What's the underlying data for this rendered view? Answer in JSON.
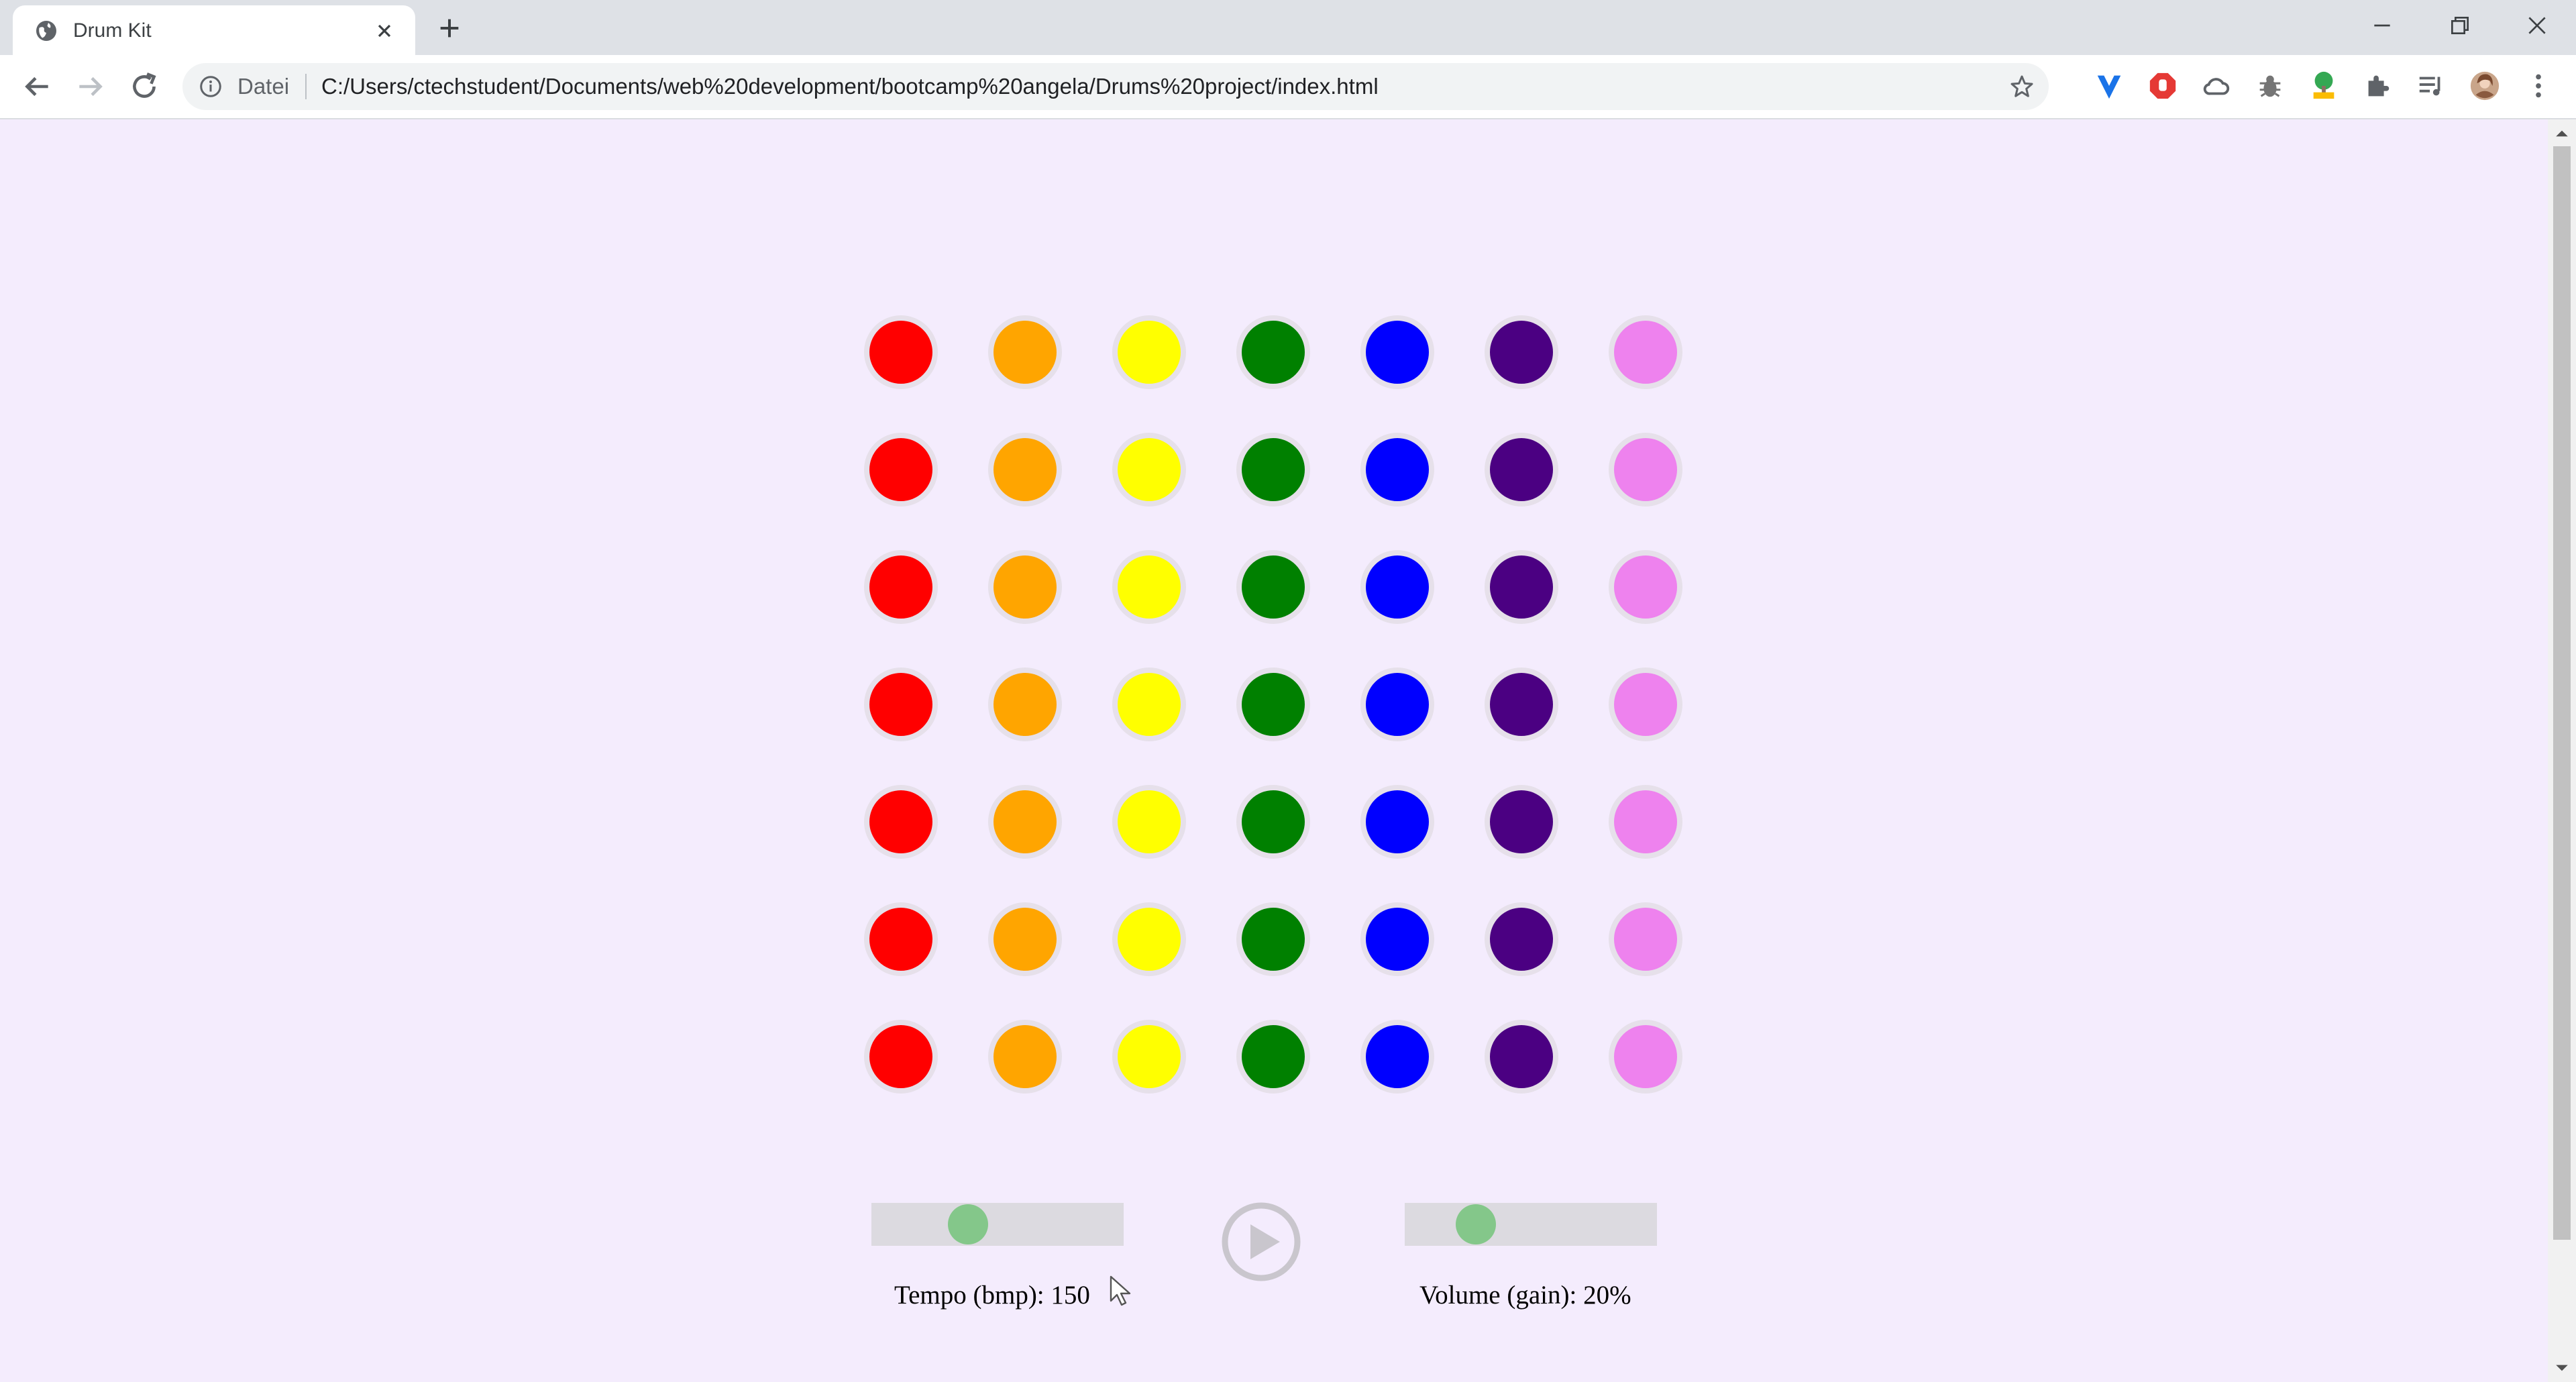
{
  "browser": {
    "tab_title": "Drum Kit",
    "scheme_label": "Datei",
    "url": "C:/Users/ctechstudent/Documents/web%20development/bootcamp%20angela/Drums%20project/index.html",
    "extensions": [
      "vpn-shield-icon",
      "adblock-hand-icon",
      "cloud-icon",
      "bug-icon",
      "html-tree-icon",
      "extensions-puzzle-icon",
      "media-queue-icon",
      "profile-avatar",
      "menu-kebab-icon"
    ]
  },
  "drum_pads": {
    "rows": 7,
    "columns": [
      {
        "name": "red",
        "color": "#ff0000"
      },
      {
        "name": "orange",
        "color": "#ffa500"
      },
      {
        "name": "yellow",
        "color": "#ffff00"
      },
      {
        "name": "green",
        "color": "#008000"
      },
      {
        "name": "blue",
        "color": "#0000ff"
      },
      {
        "name": "indigo",
        "color": "#4b0082"
      },
      {
        "name": "violet",
        "color": "#ee82ee"
      }
    ]
  },
  "controls": {
    "tempo": {
      "label": "Tempo (bmp): 150",
      "value": 150,
      "fraction": 0.36
    },
    "volume": {
      "label": "Volume (gain): 20%",
      "value": 20,
      "fraction": 0.24
    },
    "play_icon": "play-circle-icon"
  },
  "colors": {
    "page_background": "#f4ecfd",
    "slider_track": "#dcdae0",
    "slider_thumb": "#84c78a"
  }
}
